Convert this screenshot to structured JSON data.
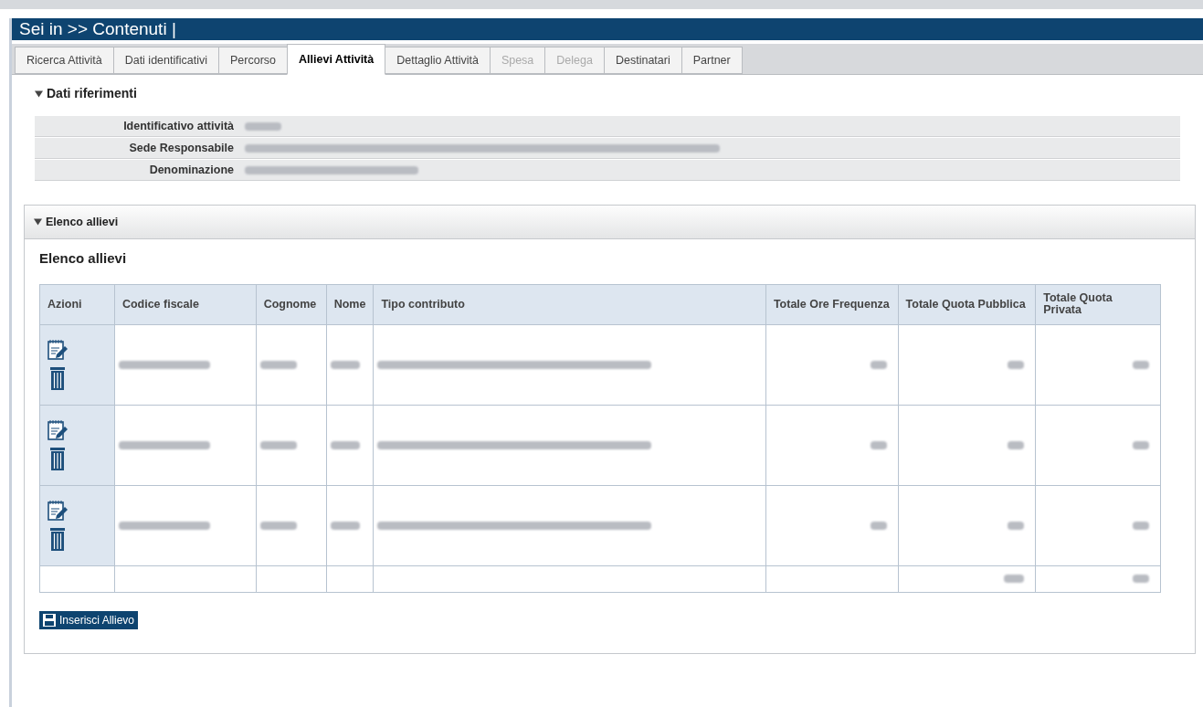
{
  "header": {
    "title": "Sei in >> Contenuti |"
  },
  "tabs": [
    {
      "label": "Ricerca Attività",
      "selected": false,
      "disabled": false
    },
    {
      "label": "Dati identificativi",
      "selected": false,
      "disabled": false
    },
    {
      "label": "Percorso",
      "selected": false,
      "disabled": false
    },
    {
      "label": "Allievi Attività",
      "selected": true,
      "disabled": false
    },
    {
      "label": "Dettaglio Attività",
      "selected": false,
      "disabled": false
    },
    {
      "label": "Spesa",
      "selected": false,
      "disabled": true
    },
    {
      "label": "Delega",
      "selected": false,
      "disabled": true
    },
    {
      "label": "Destinatari",
      "selected": false,
      "disabled": false
    },
    {
      "label": "Partner",
      "selected": false,
      "disabled": false
    }
  ],
  "references": {
    "title": "Dati riferimenti",
    "expanded": true,
    "fields": [
      {
        "label": "Identificativo attività",
        "kind": "redacted"
      },
      {
        "label": "Sede Responsabile",
        "kind": "redacted"
      },
      {
        "label": "Denominazione",
        "kind": "redacted"
      }
    ]
  },
  "students_panel": {
    "header": "Elenco allievi",
    "expanded": true,
    "title": "Elenco allievi",
    "table": {
      "columns": [
        "Azioni",
        "Codice fiscale",
        "Cognome",
        "Nome",
        "Tipo contributo",
        "Totale Ore Frequenza",
        "Totale Quota Pubblica",
        "Totale Quota Privata"
      ],
      "rows": [
        {
          "kind": "redacted"
        },
        {
          "kind": "redacted"
        },
        {
          "kind": "redacted"
        }
      ],
      "totals": {
        "kind": "redacted"
      }
    },
    "add_button": "Inserisci Allievo"
  }
}
